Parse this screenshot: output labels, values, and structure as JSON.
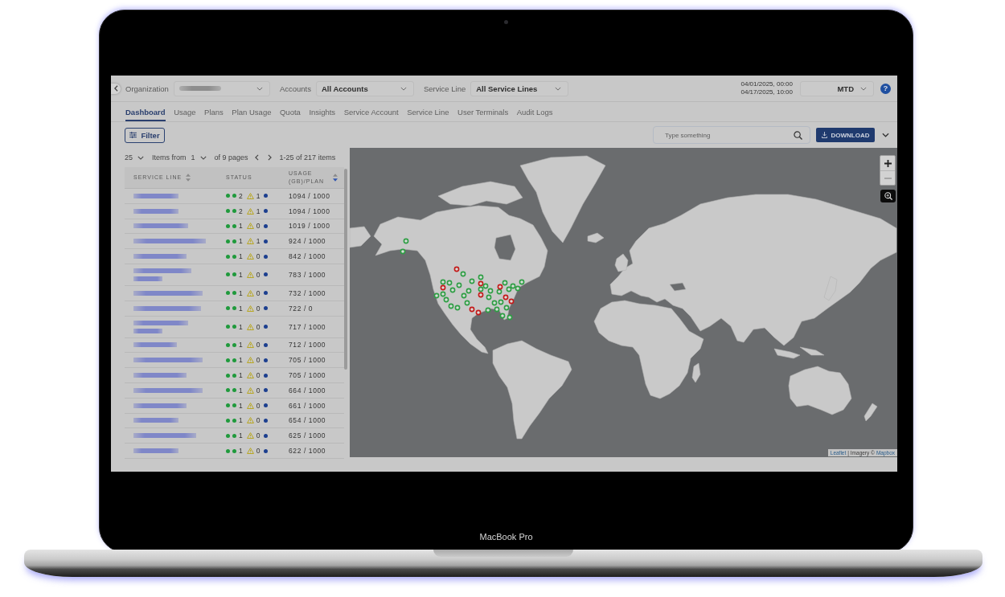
{
  "top_bar": {
    "organization_label": "Organization",
    "accounts": {
      "label": "Accounts",
      "value": "All Accounts"
    },
    "service_line": {
      "label": "Service Line",
      "value": "All Service Lines"
    },
    "date_range": {
      "start": "04/01/2025, 00:00",
      "end": "04/17/2025, 10:00"
    },
    "period": "MTD",
    "help": "?"
  },
  "tabs": [
    {
      "label": "Dashboard",
      "selected": true
    },
    {
      "label": "Usage",
      "selected": false
    },
    {
      "label": "Plans",
      "selected": false
    },
    {
      "label": "Plan Usage",
      "selected": false
    },
    {
      "label": "Quota",
      "selected": false
    },
    {
      "label": "Insights",
      "selected": false
    },
    {
      "label": "Service Account",
      "selected": false
    },
    {
      "label": "Service Line",
      "selected": false
    },
    {
      "label": "User Terminals",
      "selected": false
    },
    {
      "label": "Audit Logs",
      "selected": false
    }
  ],
  "toolbar": {
    "filter_button": "Filter",
    "search": {
      "placeholder": "Type something"
    },
    "download_button": "DOWNLOAD"
  },
  "pagination": {
    "page_size": "25",
    "items_from": "Items from",
    "page": "1",
    "of_pages": "of 9 pages",
    "range": "1-25 of 217 items"
  },
  "table": {
    "columns": [
      {
        "label": "SERVICE LINE",
        "sorted": false
      },
      {
        "label": "STATUS"
      },
      {
        "label": "USAGE (GB)/PLAN",
        "sorted": true
      }
    ],
    "rows": [
      {
        "name_wrapped": false,
        "count": "2",
        "warning_count": "1",
        "usage": "1094 / 1000"
      },
      {
        "name_wrapped": false,
        "count": "2",
        "warning_count": "1",
        "usage": "1094 / 1000"
      },
      {
        "name_wrapped": false,
        "count": "1",
        "warning_count": "0",
        "usage": "1019 / 1000"
      },
      {
        "name_wrapped": false,
        "count": "1",
        "warning_count": "1",
        "usage": "924 / 1000"
      },
      {
        "name_wrapped": false,
        "count": "1",
        "warning_count": "0",
        "usage": "842 / 1000"
      },
      {
        "name_wrapped": true,
        "count": "1",
        "warning_count": "0",
        "usage": "783 / 1000"
      },
      {
        "name_wrapped": false,
        "count": "1",
        "warning_count": "0",
        "usage": "732 / 1000"
      },
      {
        "name_wrapped": false,
        "count": "1",
        "warning_count": "0",
        "usage": "722 / 0"
      },
      {
        "name_wrapped": true,
        "count": "1",
        "warning_count": "0",
        "usage": "717 / 1000"
      },
      {
        "name_wrapped": false,
        "count": "1",
        "warning_count": "0",
        "usage": "712 / 1000"
      },
      {
        "name_wrapped": false,
        "count": "1",
        "warning_count": "0",
        "usage": "705 / 1000"
      },
      {
        "name_wrapped": false,
        "count": "1",
        "warning_count": "0",
        "usage": "705 / 1000"
      },
      {
        "name_wrapped": false,
        "count": "1",
        "warning_count": "0",
        "usage": "664 / 1000"
      },
      {
        "name_wrapped": false,
        "count": "1",
        "warning_count": "0",
        "usage": "661 / 1000"
      },
      {
        "name_wrapped": false,
        "count": "1",
        "warning_count": "0",
        "usage": "654 / 1000"
      },
      {
        "name_wrapped": false,
        "count": "1",
        "warning_count": "0",
        "usage": "625 / 1000"
      },
      {
        "name_wrapped": false,
        "count": "1",
        "warning_count": "0",
        "usage": "622 / 1000"
      }
    ]
  },
  "map": {
    "zoom_out_disabled": true,
    "markers": [
      {
        "color": "#2e9e44"
      },
      {
        "color": "#2e9e44"
      },
      {
        "color": "#c41a1a"
      },
      {
        "color": "#2e9e44"
      },
      {
        "color": "#2e9e44"
      },
      {
        "color": "#2e9e44"
      },
      {
        "color": "#2e9e44"
      },
      {
        "color": "#2e9e44"
      },
      {
        "color": "#c41a1a"
      },
      {
        "color": "#c41a1a"
      },
      {
        "color": "#2e9e44"
      },
      {
        "color": "#2e9e44"
      },
      {
        "color": "#2e9e44"
      },
      {
        "color": "#2e9e44"
      },
      {
        "color": "#2e9e44"
      },
      {
        "color": "#2e9e44"
      },
      {
        "color": "#2e9e44"
      },
      {
        "color": "#c41a1a"
      },
      {
        "color": "#2e9e44"
      },
      {
        "color": "#2e9e44"
      },
      {
        "color": "#c41a1a"
      },
      {
        "color": "#2e9e44"
      },
      {
        "color": "#2e9e44"
      },
      {
        "color": "#2e9e44"
      },
      {
        "color": "#2e9e44"
      },
      {
        "color": "#2e9e44"
      },
      {
        "color": "#c41a1a"
      },
      {
        "color": "#c41a1a"
      },
      {
        "color": "#2e9e44"
      },
      {
        "color": "#2e9e44"
      },
      {
        "color": "#2e9e44"
      },
      {
        "color": "#2e9e44"
      },
      {
        "color": "#2e9e44"
      },
      {
        "color": "#2e9e44"
      },
      {
        "color": "#c41a1a"
      },
      {
        "color": "#c41a1a"
      },
      {
        "color": "#2e9e44"
      },
      {
        "color": "#2e9e44"
      },
      {
        "color": "#2e9e44"
      },
      {
        "color": "#2e9e44"
      },
      {
        "color": "#2e9e44"
      },
      {
        "color": "#2e9e44"
      },
      {
        "color": "#2e9e44"
      }
    ],
    "attribution": {
      "leaflet_link": "Leaflet",
      "text": "| Imagery ©",
      "mapbox_link": "Mapbox"
    }
  },
  "device": {
    "label": "MacBook Pro"
  }
}
